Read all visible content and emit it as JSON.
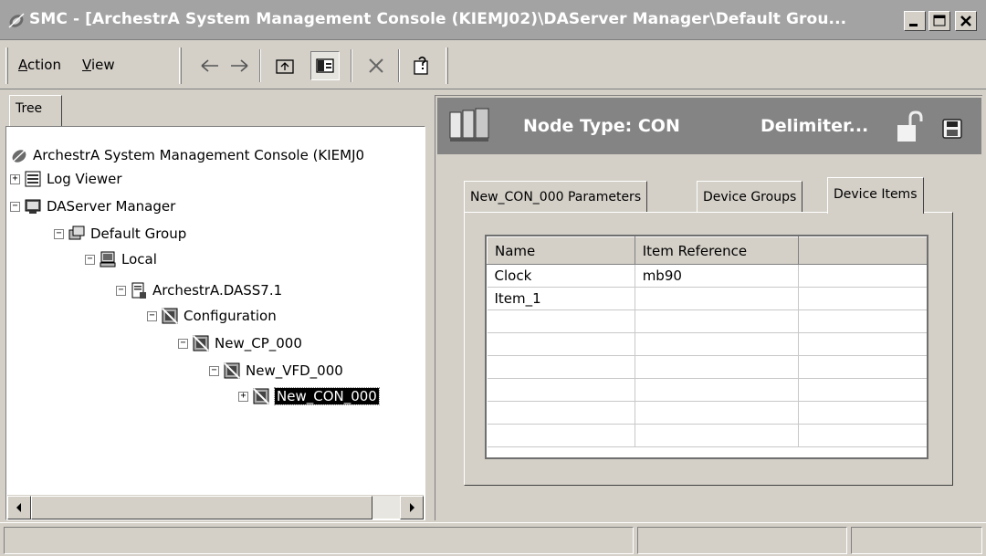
{
  "window": {
    "title": "SMC - [ArchestrA System Management Console (KIEMJ02)\\DAServer Manager\\Default Grou..."
  },
  "menu": {
    "action": "Action",
    "view": "View"
  },
  "left_pane": {
    "tab_label": "Tree",
    "tree": [
      {
        "label": "ArchestrA System Management Console (KIEMJ0",
        "icon": "console-icon"
      },
      {
        "label": "Log Viewer",
        "icon": "log-viewer-icon"
      },
      {
        "label": "DAServer Manager",
        "icon": "daserver-manager-icon"
      },
      {
        "label": "Default Group",
        "icon": "group-icon"
      },
      {
        "label": "Local",
        "icon": "computer-icon"
      },
      {
        "label": "ArchestrA.DASS7.1",
        "icon": "server-icon"
      },
      {
        "label": "Configuration",
        "icon": "configuration-icon"
      },
      {
        "label": "New_CP_000",
        "icon": "node-icon"
      },
      {
        "label": "New_VFD_000",
        "icon": "node-icon"
      },
      {
        "label": "New_CON_000",
        "icon": "node-icon"
      }
    ]
  },
  "right_pane": {
    "node_type": "Node Type: CON",
    "delimiter": "Delimiter...",
    "tabs": [
      {
        "label": "New_CON_000 Parameters"
      },
      {
        "label": "Device Groups"
      },
      {
        "label": "Device Items"
      }
    ],
    "grid": {
      "columns": [
        "Name",
        "Item Reference",
        ""
      ],
      "rows": [
        [
          "Clock",
          "mb90",
          ""
        ],
        [
          "Item_1",
          "",
          ""
        ],
        [
          "",
          "",
          ""
        ],
        [
          "",
          "",
          ""
        ],
        [
          "",
          "",
          ""
        ],
        [
          "",
          "",
          ""
        ],
        [
          "",
          "",
          ""
        ],
        [
          "",
          "",
          ""
        ]
      ]
    }
  }
}
